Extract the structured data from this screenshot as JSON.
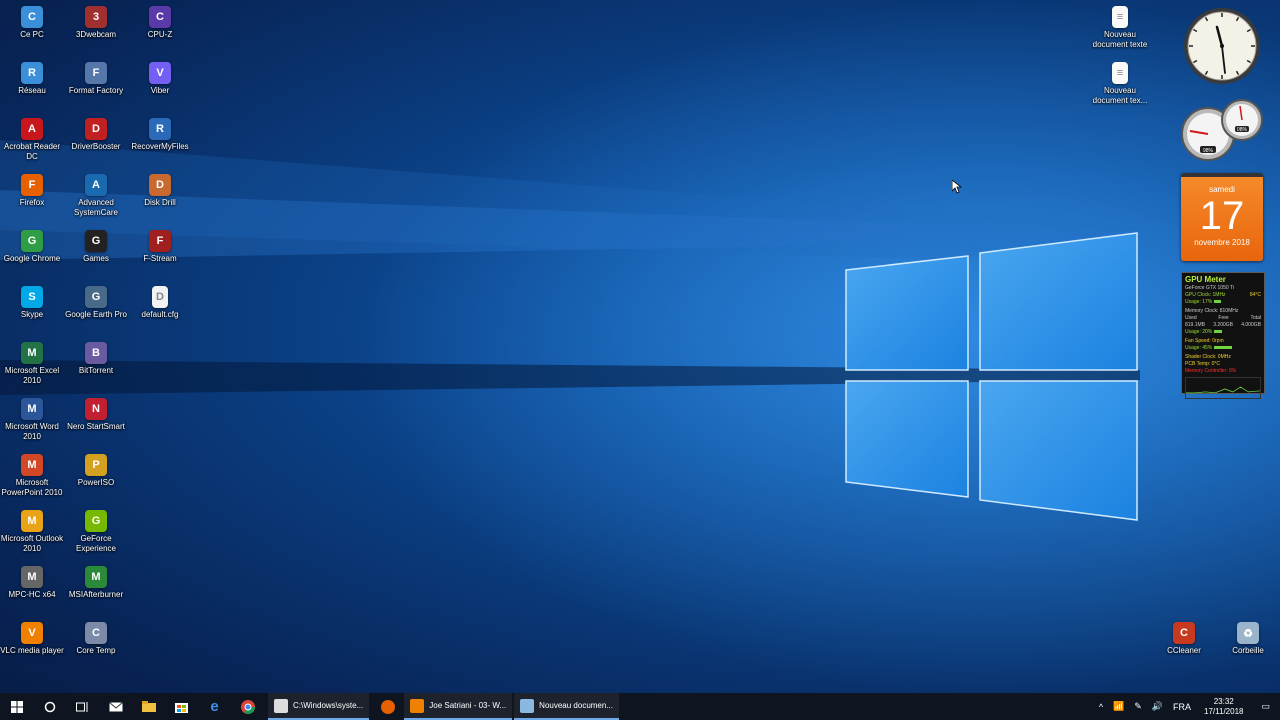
{
  "desktop": {
    "col1": [
      {
        "label": "Ce PC",
        "icon": "computer-icon",
        "color": "#3b8fd8"
      },
      {
        "label": "Réseau",
        "icon": "network-icon",
        "color": "#3b8fd8"
      },
      {
        "label": "Acrobat Reader DC",
        "icon": "acrobat-icon",
        "color": "#c8161d"
      },
      {
        "label": "Firefox",
        "icon": "firefox-icon",
        "color": "#e66000"
      },
      {
        "label": "Google Chrome",
        "icon": "chrome-icon",
        "color": "#2e9d45"
      },
      {
        "label": "Skype",
        "icon": "skype-icon",
        "color": "#00a8e8"
      },
      {
        "label": "Microsoft Excel 2010",
        "icon": "excel-icon",
        "color": "#217346"
      },
      {
        "label": "Microsoft Word 2010",
        "icon": "word-icon",
        "color": "#2b579a"
      },
      {
        "label": "Microsoft PowerPoint 2010",
        "icon": "powerpoint-icon",
        "color": "#d24726"
      },
      {
        "label": "Microsoft Outlook 2010",
        "icon": "outlook-icon",
        "color": "#e8a317"
      },
      {
        "label": "MPC-HC x64",
        "icon": "mpc-icon",
        "color": "#666666"
      },
      {
        "label": "VLC media player",
        "icon": "vlc-icon",
        "color": "#f08000"
      }
    ],
    "col2": [
      {
        "label": "3Dwebcam",
        "icon": "webcam-icon",
        "color": "#a03030"
      },
      {
        "label": "Format Factory",
        "icon": "format-factory-icon",
        "color": "#5577aa"
      },
      {
        "label": "DriverBooster",
        "icon": "driverbooster-icon",
        "color": "#c02020"
      },
      {
        "label": "Advanced SystemCare",
        "icon": "systemcare-icon",
        "color": "#1a6ab0"
      },
      {
        "label": "Games",
        "icon": "gamepad-icon",
        "color": "#222222"
      },
      {
        "label": "Google Earth Pro",
        "icon": "earth-icon",
        "color": "#4a6a8a"
      },
      {
        "label": "BitTorrent",
        "icon": "bittorrent-icon",
        "color": "#6a5aa0"
      },
      {
        "label": "Nero StartSmart",
        "icon": "nero-icon",
        "color": "#c02030"
      },
      {
        "label": "PowerISO",
        "icon": "poweriso-icon",
        "color": "#d4a020"
      },
      {
        "label": "GeForce Experience",
        "icon": "geforce-icon",
        "color": "#76b900"
      },
      {
        "label": "MSIAfterburner",
        "icon": "afterburner-icon",
        "color": "#2a8a3a"
      },
      {
        "label": "Core Temp",
        "icon": "coretemp-icon",
        "color": "#7a8aa8"
      }
    ],
    "col3": [
      {
        "label": "CPU-Z",
        "icon": "cpuz-icon",
        "color": "#5a3aa8"
      },
      {
        "label": "Viber",
        "icon": "viber-icon",
        "color": "#7360f2"
      },
      {
        "label": "RecoverMyFiles",
        "icon": "recover-icon",
        "color": "#2a6ab8"
      },
      {
        "label": "Disk Drill",
        "icon": "diskdrill-icon",
        "color": "#c86a30"
      },
      {
        "label": "F-Stream",
        "icon": "fstream-icon",
        "color": "#a02020"
      },
      {
        "label": "default.cfg",
        "icon": "file-icon",
        "color": "#f2f2f2"
      }
    ],
    "right_files": [
      {
        "label": "Nouveau document texte",
        "icon": "text-file-icon"
      },
      {
        "label": "Nouveau document tex...",
        "icon": "text-file-icon"
      }
    ],
    "bottom_right": [
      {
        "label": "CCleaner",
        "icon": "ccleaner-icon",
        "color": "#c83a20"
      },
      {
        "label": "Corbeille",
        "icon": "recycle-bin-icon",
        "color": "#9ab4cc"
      }
    ]
  },
  "gadgets": {
    "calendar": {
      "weekday": "samedi",
      "day": "17",
      "month": "novembre 2018"
    },
    "meter": {
      "left_value": "98%",
      "right_value": "08%"
    },
    "gpu_meter": {
      "title": "GPU Meter",
      "model": "GeForce GTX 1050 Ti",
      "gpu_clock": "GPU Clock: 1MHz",
      "gpu_temp": "84°C",
      "gpu_usage": "Usage: 17%",
      "gpu_usage_frac": 0.17,
      "memory_clock": "Memory Clock: 810MHz",
      "mem_headers": [
        "Used",
        "Free",
        "Total"
      ],
      "mem_values": [
        "819.1MB",
        "3.200GB",
        "4.000GB"
      ],
      "mem_usage": "Usage: 20%",
      "mem_usage_frac": 0.2,
      "fan_speed": "Fan Speed: 0rpm",
      "fan_usage": "Usage: 45%",
      "fan_usage_frac": 0.45,
      "shader_clock": "Shader Clock: 0MHz",
      "pcb_temp": "PCB Temp: 0°C",
      "mem_controller": "Memory Controller: 0%"
    }
  },
  "taskbar": {
    "tasks": [
      {
        "label": "C:\\Windows\\syste...",
        "icon": "cmd-icon",
        "color": "#dddddd"
      },
      {
        "label": "Joe Satriani - 03- W...",
        "icon": "vlc-icon",
        "color": "#f08000"
      },
      {
        "label": "Nouveau documen...",
        "icon": "notepad-icon",
        "color": "#8ab8e0"
      }
    ],
    "language": "FRA",
    "time": "23:32",
    "date": "17/11/2018"
  },
  "colors": {
    "accent": "#6fa8e8",
    "taskbar": "#0f1520"
  }
}
